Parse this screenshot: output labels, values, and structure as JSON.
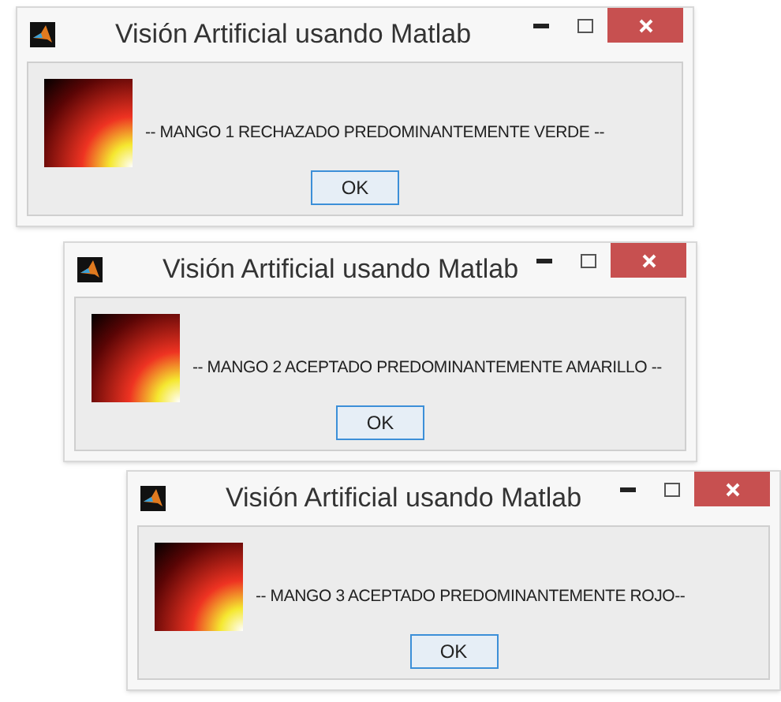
{
  "windows": [
    {
      "title": "Visión Artificial usando Matlab",
      "message": "-- MANGO 1 RECHAZADO PREDOMINANTEMENTE VERDE --",
      "button": "OK"
    },
    {
      "title": "Visión Artificial usando Matlab",
      "message": "-- MANGO 2 ACEPTADO PREDOMINANTEMENTE AMARILLO --",
      "button": "OK"
    },
    {
      "title": "Visión Artificial usando Matlab",
      "message": "-- MANGO 3 ACEPTADO PREDOMINANTEMENTE ROJO--",
      "button": "OK"
    }
  ]
}
